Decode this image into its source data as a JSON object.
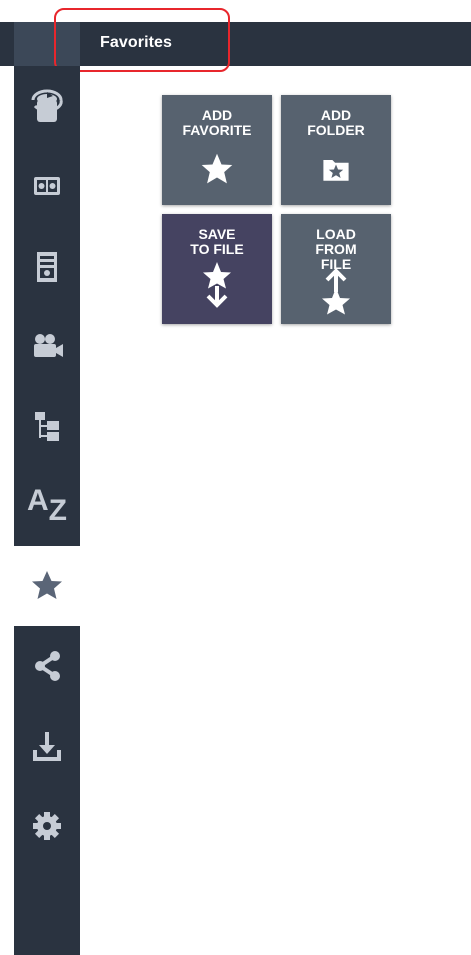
{
  "header": {
    "title": "Favorites"
  },
  "sidebar": {
    "items": [
      {
        "icon": "rotate-view-icon",
        "active": false
      },
      {
        "icon": "id-card-icon",
        "active": false
      },
      {
        "icon": "building-icon",
        "active": false
      },
      {
        "icon": "video-camera-icon",
        "active": false
      },
      {
        "icon": "hierarchy-tree-icon",
        "active": false
      },
      {
        "icon": "alphabetical-icon",
        "label": "AZ",
        "active": false
      },
      {
        "icon": "star-icon",
        "active": true
      },
      {
        "icon": "share-icon",
        "active": false
      },
      {
        "icon": "download-icon",
        "active": false
      },
      {
        "icon": "gear-icon",
        "active": false
      }
    ]
  },
  "tiles": [
    {
      "label": "ADD\nFAVORITE",
      "icon": "star-icon"
    },
    {
      "label": "ADD\nFOLDER",
      "icon": "folder-star-icon"
    },
    {
      "label": "SAVE\nTO FILE",
      "icon": "star-arrow-down-icon"
    },
    {
      "label": "LOAD\nFROM\nFILE",
      "icon": "arrow-up-star-icon"
    }
  ],
  "colors": {
    "header_bg": "#2a3340",
    "sidebar_bg": "#2a3340",
    "icon": "#c6ccd5",
    "active_icon": "#5a6577",
    "tile_bg": "#57626f",
    "tile_selected_bg": "#454361",
    "highlight": "#e8262c"
  }
}
